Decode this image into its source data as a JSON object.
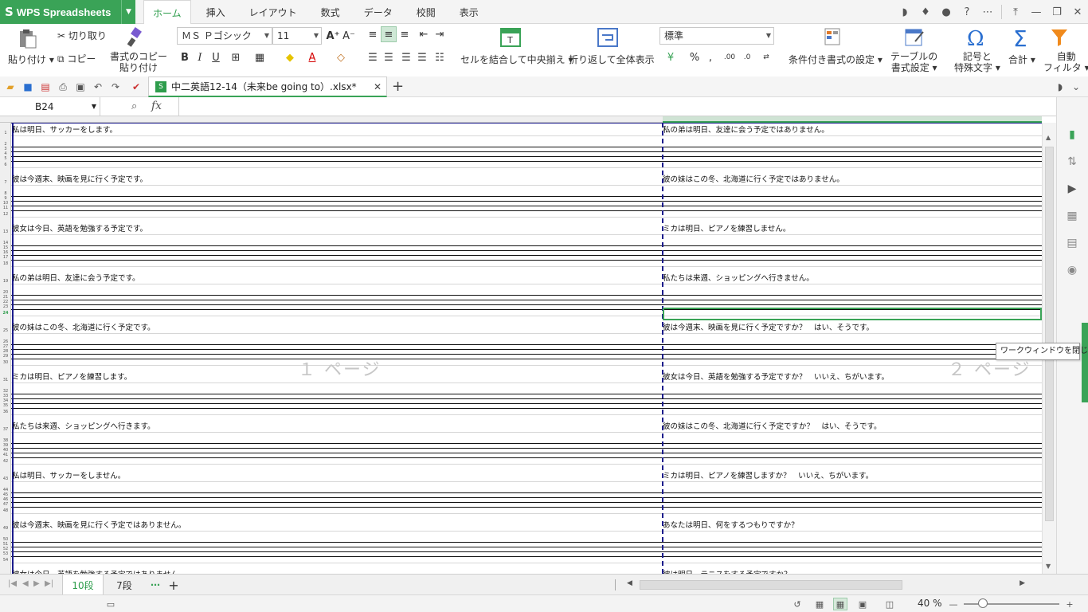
{
  "app": {
    "name": "WPS Spreadsheets"
  },
  "menu": {
    "tabs": [
      "ホーム",
      "挿入",
      "レイアウト",
      "数式",
      "データ",
      "校閲",
      "表示"
    ],
    "active": "ホーム"
  },
  "ribbon": {
    "paste": "貼り付け",
    "cut": "切り取り",
    "copy": "コピー",
    "format_copy_line1": "書式のコピー",
    "format_copy_line2": "貼り付け",
    "font_name": "ＭＳ Ｐゴシック",
    "font_size": "11",
    "merge_center": "セルを結合して中央揃え",
    "wrap": "折り返して全体表示",
    "number_format": "標準",
    "conditional": "条件付き書式の設定",
    "table_line1": "テーブルの",
    "table_line2": "書式設定",
    "symbol_line1": "記号と",
    "symbol_line2": "特殊文字",
    "sum": "合計",
    "filter_line1": "自動",
    "filter_line2": "フィルタ"
  },
  "document": {
    "tab_title": "中二英語12-14（未来be going to）.xlsx*"
  },
  "formula_bar": {
    "name_box": "B24",
    "fx": "fx",
    "content": ""
  },
  "sheet": {
    "left_column": [
      "私は明日、サッカーをします。",
      "彼は今週末、映画を見に行く予定です。",
      "彼女は今日、英語を勉強する予定です。",
      "私の弟は明日、友達に会う予定です。",
      "彼の妹はこの冬、北海道に行く予定です。",
      "ミカは明日、ピアノを練習します。",
      "私たちは来週、ショッピングへ行きます。",
      "私は明日、サッカーをしません。",
      "彼は今週末、映画を見に行く予定ではありません。",
      "彼女は今日、英語を勉強する予定ではありません。"
    ],
    "right_column": [
      "私の弟は明日、友達に会う予定ではありません。",
      "彼の妹はこの冬、北海道に行く予定ではありません。",
      "ミカは明日、ピアノを練習しません。",
      "私たちは来週、ショッピングへ行きません。",
      "彼は今週末、映画を見に行く予定ですか？　はい、そうです。",
      "彼女は今日、英語を勉強する予定ですか？　いいえ、ちがいます。",
      "彼の妹はこの冬、北海道に行く予定ですか？　はい、そうです。",
      "ミカは明日、ピアノを練習しますか？　いいえ、ちがいます。",
      "あなたは明日、何をするつもりですか？",
      "彼は明日、テニスをする予定ですか？"
    ],
    "row_numbers": [
      "1",
      "2",
      "3",
      "4",
      "5",
      "6",
      "7",
      "8",
      "9",
      "10",
      "11",
      "12",
      "13",
      "14",
      "15",
      "16",
      "17",
      "18",
      "19",
      "20",
      "21",
      "22",
      "23",
      "24",
      "25",
      "26",
      "27",
      "28",
      "29",
      "30",
      "31",
      "32",
      "33",
      "34",
      "35",
      "36",
      "37",
      "38",
      "39",
      "40",
      "41",
      "42",
      "43",
      "44",
      "45",
      "46",
      "47",
      "48",
      "49",
      "50",
      "51",
      "52",
      "53",
      "54"
    ],
    "selected_row": "24",
    "page_label_1": "１ ページ",
    "page_label_2": "２ ページ"
  },
  "tooltip": "ワークウィンドウを閉じる",
  "sheet_tabs": {
    "tabs": [
      "10段",
      "7段"
    ],
    "active": "10段"
  },
  "status": {
    "zoom": "40 %"
  },
  "colors": {
    "accent": "#3aa357",
    "page_break": "#1b1b8c"
  }
}
